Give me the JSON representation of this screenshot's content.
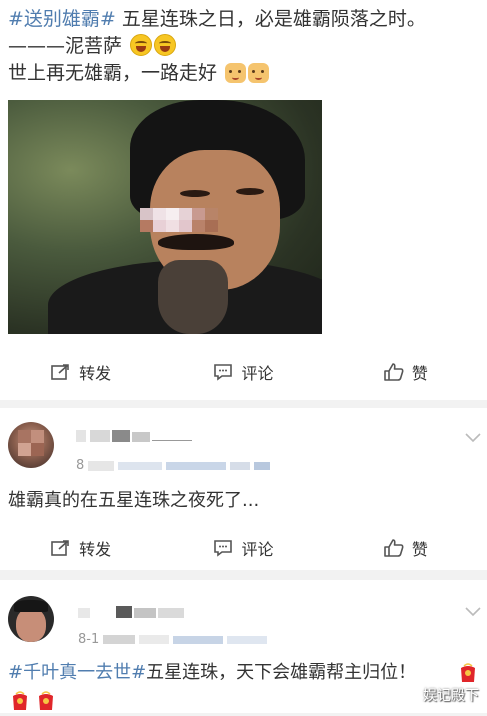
{
  "post1": {
    "hashtag": "#送别雄霸#",
    "line1_rest": " 五星连珠之日，必是雄霸陨落之时。",
    "line2": "———泥菩萨",
    "line3": "世上再无雄霸，一路走好",
    "emojis_line2": [
      "laugh-cry-emoji",
      "laugh-cry-emoji"
    ],
    "emojis_line3": [
      "cat-emoji",
      "cat-emoji"
    ]
  },
  "actions": {
    "repost": "转发",
    "comment": "评论",
    "like": "赞"
  },
  "comment1": {
    "meta_prefix": "8",
    "text": "雄霸真的在五星连珠之夜死了..."
  },
  "comment2": {
    "meta_prefix": "8-1",
    "hashtag": "#千叶真一去世#",
    "text_rest": "五星连珠，天下会雄霸帮主归位！"
  },
  "watermark": "娱记殿下",
  "colors": {
    "link": "#507daf",
    "text": "#333333",
    "muted": "#999999",
    "separator": "#f2f2f2",
    "red_emoji": "#e0262a"
  }
}
